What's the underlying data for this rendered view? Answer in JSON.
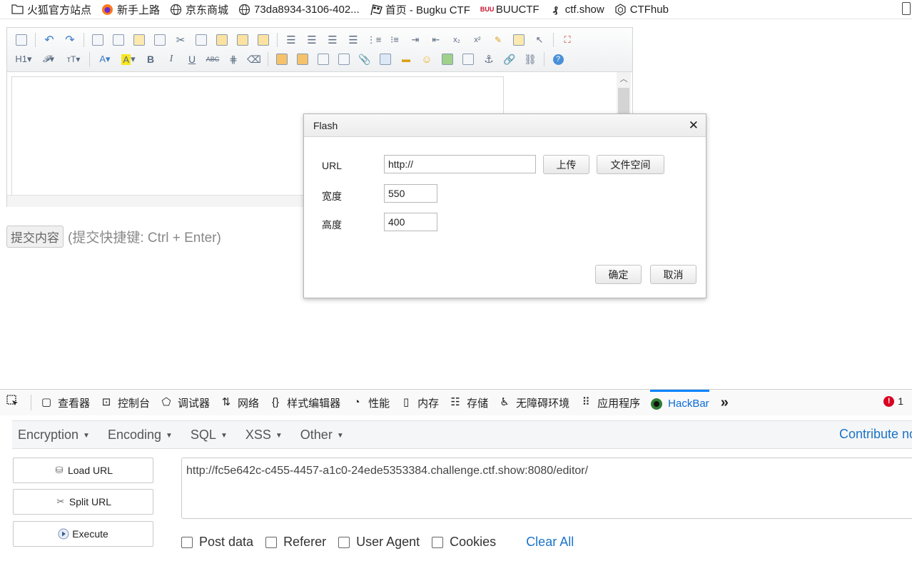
{
  "bookmarks": [
    {
      "label": "火狐官方站点",
      "icon": "folder-icon"
    },
    {
      "label": "新手上路",
      "icon": "firefox-icon"
    },
    {
      "label": "京东商城",
      "icon": "globe-icon"
    },
    {
      "label": "73da8934-3106-402...",
      "icon": "globe-icon"
    },
    {
      "label": "首页 - Bugku CTF",
      "icon": "flag-icon"
    },
    {
      "label": "BUUCTF",
      "icon": "buuctf-icon"
    },
    {
      "label": "ctf.show",
      "icon": "ctfshow-icon"
    },
    {
      "label": "CTFhub",
      "icon": "ctfhub-icon"
    }
  ],
  "editor": {
    "submit_label": "提交内容",
    "submit_hint": "(提交快捷键: Ctrl + Enter)"
  },
  "dialog": {
    "title": "Flash",
    "url_label": "URL",
    "url_value": "http://",
    "upload_label": "上传",
    "file_space_label": "文件空间",
    "width_label": "宽度",
    "width_value": "550",
    "height_label": "高度",
    "height_value": "400",
    "ok_label": "确定",
    "cancel_label": "取消"
  },
  "devtools": {
    "tabs": [
      {
        "label": "查看器",
        "icon": "inspector-icon"
      },
      {
        "label": "控制台",
        "icon": "console-icon"
      },
      {
        "label": "调试器",
        "icon": "debugger-icon"
      },
      {
        "label": "网络",
        "icon": "network-icon"
      },
      {
        "label": "样式编辑器",
        "icon": "style-editor-icon"
      },
      {
        "label": "性能",
        "icon": "performance-icon"
      },
      {
        "label": "内存",
        "icon": "memory-icon"
      },
      {
        "label": "存储",
        "icon": "storage-icon"
      },
      {
        "label": "无障碍环境",
        "icon": "accessibility-icon"
      },
      {
        "label": "应用程序",
        "icon": "application-icon"
      },
      {
        "label": "HackBar",
        "icon": "hackbar-icon"
      }
    ],
    "active_tab": "HackBar",
    "error_count": "1"
  },
  "hackbar": {
    "menus": [
      "Encryption",
      "Encoding",
      "SQL",
      "XSS",
      "Other"
    ],
    "contribute": "Contribute no",
    "load_url": "Load URL",
    "split_url": "Split URL",
    "execute": "Execute",
    "url": "http://fc5e642c-c455-4457-a1c0-24ede5353384.challenge.ctf.show:8080/editor/",
    "checks": [
      "Post data",
      "Referer",
      "User Agent",
      "Cookies"
    ],
    "clear_all": "Clear All"
  }
}
